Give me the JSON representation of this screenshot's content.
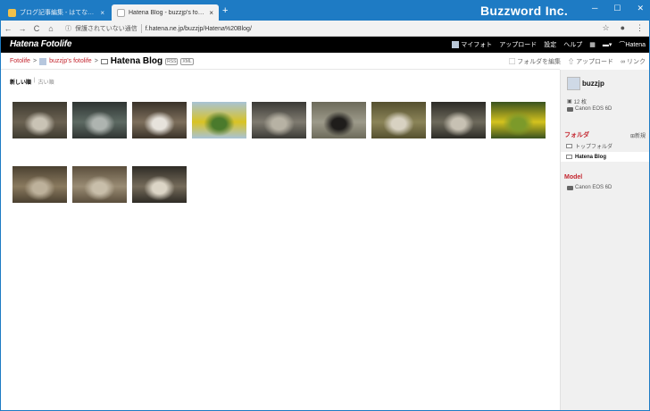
{
  "browser": {
    "tabs": [
      {
        "title": "ブログ記事編集 - はてなブログ",
        "close": "×",
        "favicon_color": "#f0c14b"
      },
      {
        "title": "Hatena Blog - buzzjp's fotolife",
        "close": "×",
        "favicon_color": "#ffffff"
      }
    ],
    "new_tab": "+",
    "brand": "Buzzword Inc.",
    "window_controls": {
      "minimize": "─",
      "maximize": "☐",
      "close": "✕"
    },
    "nav": {
      "back": "←",
      "forward": "→",
      "reload": "C",
      "home": "⌂"
    },
    "security_label": "保護されていない通信",
    "url": "f.hatena.ne.jp/buzzjp/Hatena%20Blog/",
    "toolbar_icons": {
      "bookmark": "☆",
      "profile": "●",
      "menu": "⋮"
    }
  },
  "hatena_header": {
    "logo": "Hatena Fotolife",
    "nav": [
      "マイフォト",
      "アップロード",
      "設定",
      "ヘルプ"
    ],
    "grid": "▦",
    "chat": "▾",
    "account": "Hatena"
  },
  "breadcrumb": {
    "root": "Fotolife",
    "sep": ">",
    "user": "buzzjp's fotolife",
    "current": "Hatena Blog",
    "badges": [
      "RSS",
      "XML"
    ]
  },
  "actions": {
    "edit_folder": "フォルダを編集",
    "upload": "アップロード",
    "link": "リンク"
  },
  "sort": {
    "newest": "新しい順",
    "divider": "|",
    "oldest": "古い順"
  },
  "photos": [
    {
      "scene": "sheep-barn",
      "colors": [
        "#3e3a30",
        "#6b6252",
        "#c9c3b5"
      ]
    },
    {
      "scene": "emu",
      "colors": [
        "#2f3432",
        "#5d6a63",
        "#aeb4b0"
      ]
    },
    {
      "scene": "white-animal",
      "colors": [
        "#3a3229",
        "#7d6f5c",
        "#e7e3dc"
      ]
    },
    {
      "scene": "rapeseed-field",
      "colors": [
        "#a8c3d6",
        "#d9c324",
        "#4a7a2c"
      ]
    },
    {
      "scene": "goat-stones",
      "colors": [
        "#3b3a36",
        "#7f7b70",
        "#b7b2a4"
      ]
    },
    {
      "scene": "black-goat",
      "colors": [
        "#6c6a5a",
        "#9d9a8a",
        "#1f1d1b"
      ]
    },
    {
      "scene": "sheep-field",
      "colors": [
        "#55502f",
        "#8b8458",
        "#d8d2c2"
      ]
    },
    {
      "scene": "fence-animal",
      "colors": [
        "#2c2b26",
        "#6e6a5c",
        "#c7c1b3"
      ]
    },
    {
      "scene": "yellow-flowers",
      "colors": [
        "#39521f",
        "#d4c21e",
        "#7c9a2a"
      ]
    },
    {
      "scene": "emu-pen",
      "colors": [
        "#4a4030",
        "#8a7a5f",
        "#bdb19b"
      ]
    },
    {
      "scene": "sheep-pen",
      "colors": [
        "#5a4e3c",
        "#9a8c74",
        "#c8beaa"
      ]
    },
    {
      "scene": "goat-feeding",
      "colors": [
        "#2e2b25",
        "#756b5a",
        "#dcd5c6"
      ]
    }
  ],
  "sidebar": {
    "user": "buzzjp",
    "photo_count": "12 枚",
    "camera": "Canon EOS 6D",
    "folder_heading": "フォルダ",
    "new_label": "新規",
    "folders": [
      "トップフォルダ",
      "Hatena Blog"
    ],
    "model_heading": "Model",
    "models": [
      "Canon EOS 6D"
    ]
  },
  "colors": {
    "accent": "#c4262f",
    "chrome_blue": "#1e7bc4"
  }
}
